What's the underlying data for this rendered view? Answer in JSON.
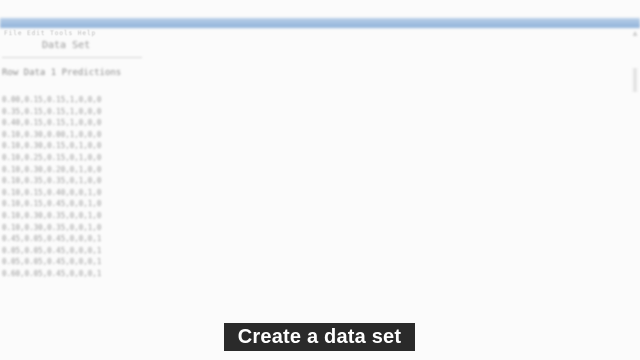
{
  "window": {
    "menu": "File  Edit  Tools  Help"
  },
  "document": {
    "title": "Data Set",
    "header": "Row Data 1 Predictions",
    "rows": [
      "0.00,0.15,0.15,1,0,0,0",
      "0.35,0.15,0.15,1,0,0,0",
      "0.40,0.15,0.15,1,0,0,0",
      "0.10,0.30,0.00,1,0,0,0",
      "0.10,0.30,0.15,0,1,0,0",
      "0.10,0.25,0.15,0,1,0,0",
      "0.10,0.30,0.20,0,1,0,0",
      "0.10,0.35,0.35,0,1,0,0",
      "0.10,0.15,0.40,0,0,1,0",
      "0.10,0.15,0.45,0,0,1,0",
      "0.10,0.30,0.35,0,0,1,0",
      "0.10,0.30,0.35,0,0,1,0",
      "0.45,0.05,0.45,0,0,0,1",
      "0.05,0.05,0.45,0,0,0,1",
      "0.05,0.05,0.45,0,0,0,1",
      "0.60,0.05,0.45,0,0,0,1"
    ]
  },
  "caption": {
    "text": "Create a data set"
  },
  "colors": {
    "titlebar": "#8fb2d9",
    "caption_bg": "#2a2a2a",
    "caption_fg": "#ffffff"
  }
}
